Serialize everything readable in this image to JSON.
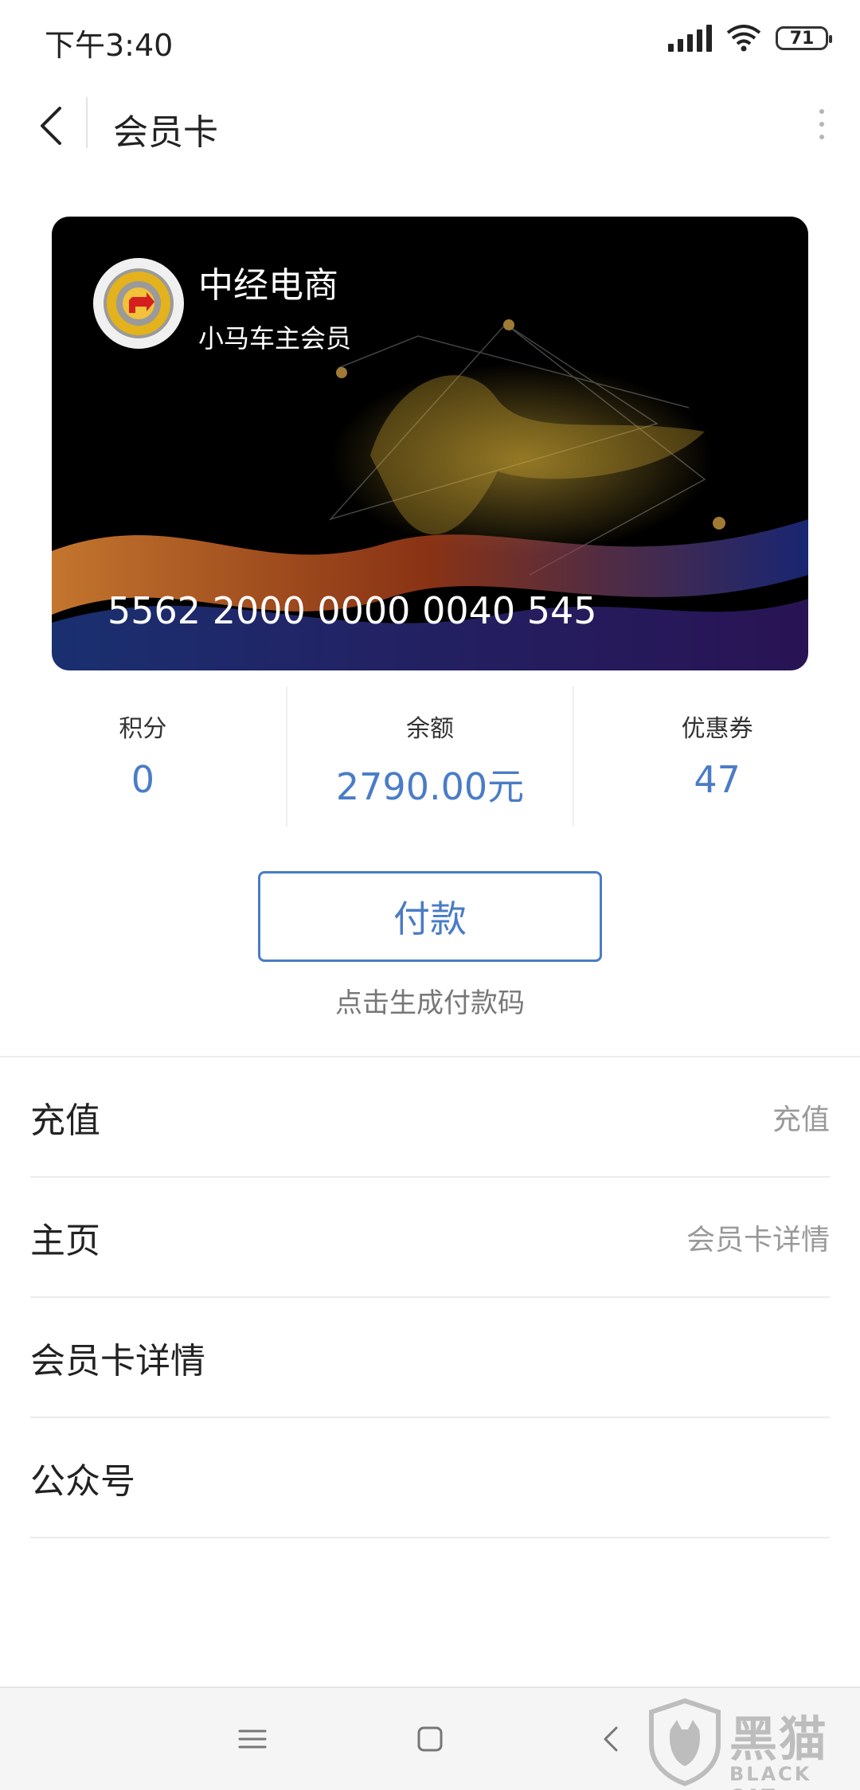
{
  "status_bar": {
    "time": "下午3:40",
    "battery": "71"
  },
  "header": {
    "title": "会员卡"
  },
  "card": {
    "merchant_name": "中经电商",
    "member_level": "小马车主会员",
    "card_number": "5562 2000 0000 0040 545"
  },
  "stats": [
    {
      "label": "积分",
      "value": "0"
    },
    {
      "label": "余额",
      "value": "2790.00元"
    },
    {
      "label": "优惠券",
      "value": "47"
    }
  ],
  "pay": {
    "button_label": "付款",
    "hint": "点击生成付款码"
  },
  "menu": [
    {
      "label": "充值",
      "value": "充值"
    },
    {
      "label": "主页",
      "value": "会员卡详情"
    },
    {
      "label": "会员卡详情",
      "value": ""
    },
    {
      "label": "公众号",
      "value": ""
    }
  ],
  "watermark": {
    "text": "黑猫",
    "sub": "BLACK CAT"
  },
  "colors": {
    "accent": "#4a7cc7",
    "card_bg": "#000000"
  }
}
